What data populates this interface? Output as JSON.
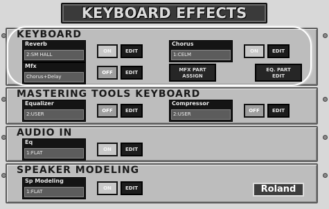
{
  "title": "KEYBOARD EFFECTS",
  "sections": {
    "keyboard": {
      "heading": "KEYBOARD",
      "reverb": {
        "label": "Reverb",
        "value": "2:SM HALL",
        "toggle": "ON",
        "edit": "EDIT"
      },
      "chorus": {
        "label": "Chorus",
        "value": "1:CELM",
        "toggle": "ON",
        "edit": "EDIT"
      },
      "mfx": {
        "label": "Mfx",
        "value": "Chorus+Delay",
        "toggle": "OFF",
        "edit": "EDIT"
      },
      "mfx_part": {
        "line1": "MFX PART",
        "line2": "ASSIGN"
      },
      "eq_part": {
        "line1": "EQ. PART",
        "line2": "EDIT"
      }
    },
    "mastering": {
      "heading": "MASTERING TOOLS KEYBOARD",
      "equalizer": {
        "label": "Equalizer",
        "value": "2:USER",
        "toggle": "OFF",
        "edit": "EDIT"
      },
      "compressor": {
        "label": "Compressor",
        "value": "2:USER",
        "toggle": "OFF",
        "edit": "EDIT"
      }
    },
    "audio_in": {
      "heading": "AUDIO IN",
      "eq": {
        "label": "Eq",
        "value": "1:FLAT",
        "toggle": "ON",
        "edit": "EDIT"
      }
    },
    "speaker": {
      "heading": "SPEAKER MODELING",
      "sp_modeling": {
        "label": "Sp Modeling",
        "value": "1:FLAT",
        "toggle": "ON",
        "edit": "EDIT"
      },
      "brand": "Roland"
    }
  }
}
